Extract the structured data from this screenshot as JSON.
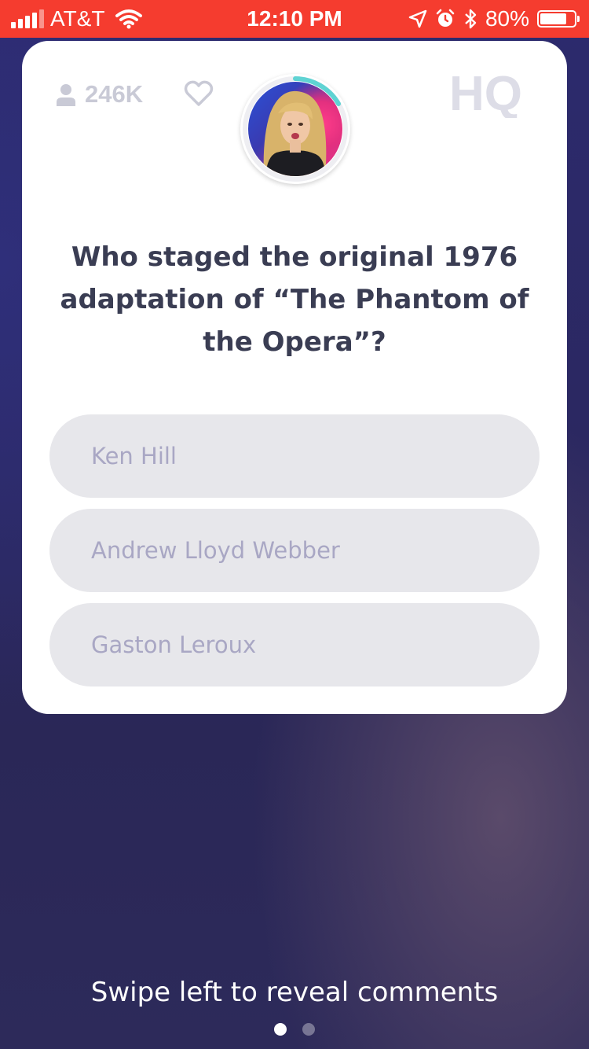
{
  "status_bar": {
    "carrier": "AT&T",
    "time": "12:10 PM",
    "battery_percent": "80%",
    "battery_level": 0.8,
    "icons": [
      "signal-icon",
      "wifi-icon",
      "location-icon",
      "alarm-icon",
      "bluetooth-icon",
      "battery-icon"
    ]
  },
  "card": {
    "viewer_count": "246K",
    "logo_text": "HQ",
    "question": "Who staged the original 1976 adaptation of “The Phantom of the Opera”?",
    "answers": [
      {
        "label": "Ken Hill"
      },
      {
        "label": "Andrew Lloyd Webber"
      },
      {
        "label": "Gaston Leroux"
      }
    ]
  },
  "footer": {
    "hint": "Swipe left to reveal comments",
    "page_indicator": {
      "count": 2,
      "active": 1
    }
  },
  "colors": {
    "status_bar": "#f53c2f",
    "question_text": "#3a3d53",
    "answer_bg": "#e7e7eb",
    "answer_text": "#a9a7c4",
    "muted_icon": "#c9cad6",
    "timer_ring": "#5fd3d3"
  }
}
